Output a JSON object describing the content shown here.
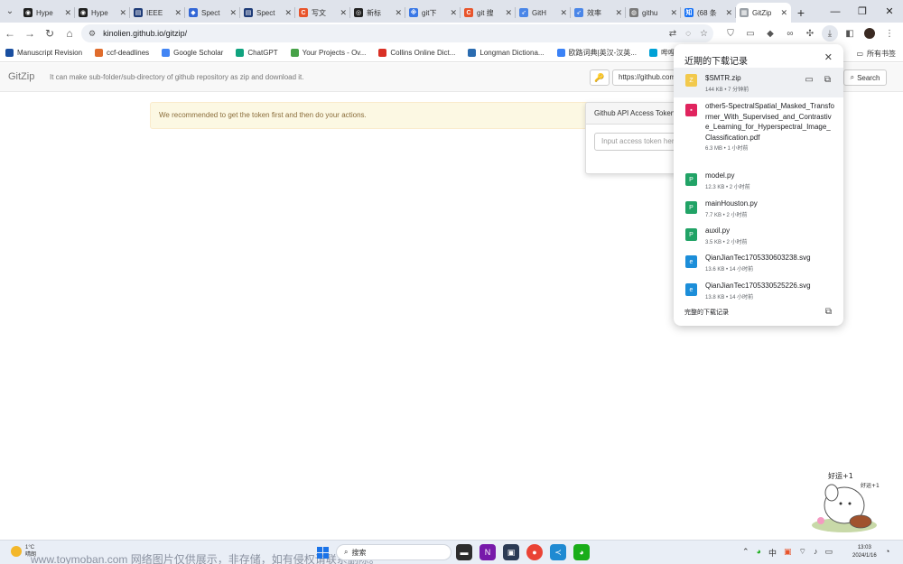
{
  "browser": {
    "tabs": [
      {
        "title": "Hype",
        "color": "#1f1f1f",
        "glyph": "◉"
      },
      {
        "title": "Hype",
        "color": "#1f1f1f",
        "glyph": "◉"
      },
      {
        "title": "IEEE",
        "color": "#1f3c78",
        "glyph": "▤"
      },
      {
        "title": "Spect",
        "color": "#3367d6",
        "glyph": "◆"
      },
      {
        "title": "Spect",
        "color": "#1f3c78",
        "glyph": "▤"
      },
      {
        "title": "写文",
        "color": "#e8542b",
        "glyph": "C"
      },
      {
        "title": "新标",
        "color": "#222222",
        "glyph": "◎"
      },
      {
        "title": "git下",
        "color": "#3a78e6",
        "glyph": "※"
      },
      {
        "title": "git 搜",
        "color": "#e8542b",
        "glyph": "C"
      },
      {
        "title": "GitH",
        "color": "#4a86e8",
        "glyph": "➶"
      },
      {
        "title": "效率",
        "color": "#4a86e8",
        "glyph": "➶"
      },
      {
        "title": "githu",
        "color": "#7a7a7a",
        "glyph": "◍"
      },
      {
        "title": "(68 条",
        "color": "#1772f6",
        "glyph": "知"
      },
      {
        "title": "GitZip",
        "color": "#9aa0a6",
        "glyph": "▦",
        "active": true
      }
    ],
    "new_tab": "+",
    "url": "kinolien.github.io/gitzip/"
  },
  "bookmarks": [
    {
      "label": "Manuscript Revision",
      "color": "#1a4fa0"
    },
    {
      "label": "ccf-deadlines",
      "color": "#e06c2c"
    },
    {
      "label": "Google Scholar",
      "color": "#4285f4"
    },
    {
      "label": "ChatGPT",
      "color": "#10a37f"
    },
    {
      "label": "Your Projects - Ov...",
      "color": "#47a248"
    },
    {
      "label": "Collins Online Dict...",
      "color": "#d93025"
    },
    {
      "label": "Longman Dictiona...",
      "color": "#2b6cb0"
    },
    {
      "label": "欧路词典|英汉-汉英...",
      "color": "#3b82f6"
    },
    {
      "label": "哔哩哔哩 (゜-゜)つ...",
      "color": "#00a1d6"
    }
  ],
  "bookmarks_all": "所有书签",
  "gitzip": {
    "brand": "GitZip",
    "description": "It can make sub-folder/sub-directory of github repository as zip and download it.",
    "url_field": "https://github.com",
    "search_label": "Search",
    "alert": "We recommended to get the token first and then do your actions.",
    "token_title": "Github API Access Token",
    "token_placeholder": "Input access token here"
  },
  "downloads": {
    "title": "近期的下载记录",
    "footer": "完整的下载记录",
    "items": [
      {
        "name": "$SMTR.zip",
        "meta": "144 KB • 7 分钟前",
        "icon_color": "#f2c94c",
        "icon_glyph": "Z"
      },
      {
        "name": "other5-SpectralSpatial_Masked_Transformer_With_Supervised_and_Contrastive_Learning_for_Hyperspectral_Image_Classification.pdf",
        "meta": "6.3 MB • 1 小时前",
        "icon_color": "#e0245e",
        "icon_glyph": "▪"
      },
      {
        "name": "model.py",
        "meta": "12.3 KB • 2 小时前",
        "icon_color": "#21a366",
        "icon_glyph": "P"
      },
      {
        "name": "mainHouston.py",
        "meta": "7.7 KB • 2 小时前",
        "icon_color": "#21a366",
        "icon_glyph": "P"
      },
      {
        "name": "auxil.py",
        "meta": "3.5 KB • 2 小时前",
        "icon_color": "#21a366",
        "icon_glyph": "P"
      },
      {
        "name": "QianJianTec1705330603238.svg",
        "meta": "13.6 KB • 14 小时前",
        "icon_color": "#1c8ed9",
        "icon_glyph": "e"
      },
      {
        "name": "QianJianTec1705330525226.svg",
        "meta": "13.8 KB • 14 小时前",
        "icon_color": "#1c8ed9",
        "icon_glyph": "e"
      }
    ]
  },
  "sticker": {
    "top_text": "好运+1",
    "side_text": "好运+1"
  },
  "taskbar": {
    "temperature": "1°C",
    "weather": "晴朗",
    "watermark": "www.toymoban.com 网络图片仅供展示，非存储，如有侵权请联系删除。",
    "search_label": "搜索",
    "time": "13:03",
    "date": "2024/1/16"
  }
}
